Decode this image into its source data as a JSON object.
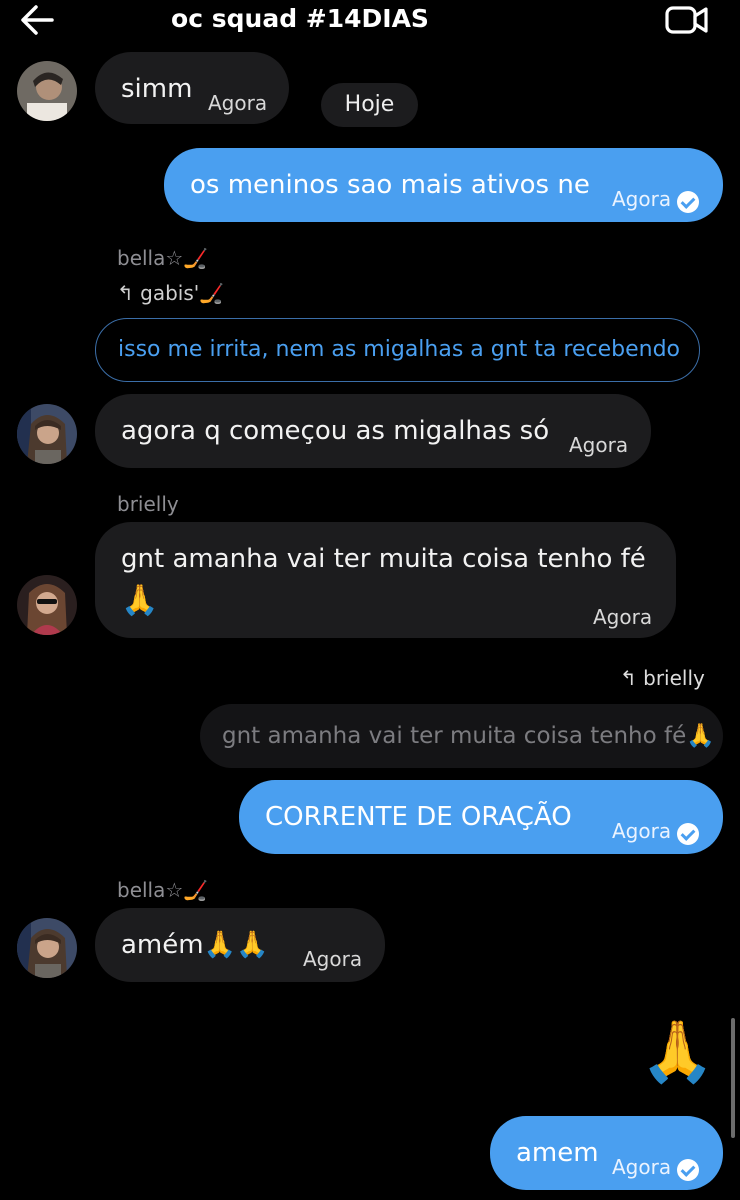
{
  "header": {
    "title": "oc squad #14DIAS",
    "back_icon": "arrow-left-icon",
    "video_icon": "video-camera-icon"
  },
  "colors": {
    "background": "#000000",
    "incoming": "#1c1c1e",
    "outgoing": "#4a9ff0",
    "quote_outline": "#3b6ea8"
  },
  "date_separator": "Hoje",
  "messages": [
    {
      "text": "simm",
      "time": "Agora"
    },
    {
      "text": "os meninos sao mais ativos ne",
      "time": "Agora"
    },
    {
      "sender": "bella☆🏒",
      "reply_to": "gabis'🏒",
      "quoted": "isso me irrita, nem as migalhas a gnt ta recebendo",
      "text": "agora q começou as migalhas só",
      "time": "Agora"
    },
    {
      "sender": "brielly",
      "text_line1": "gnt amanha vai ter muita coisa tenho fé",
      "text_line2": "🙏",
      "time": "Agora"
    },
    {
      "reply_to": "brielly",
      "quoted": "gnt amanha vai ter muita coisa tenho fé🙏",
      "text": "CORRENTE DE ORAÇÃO",
      "time": "Agora"
    },
    {
      "sender": "bella☆🏒",
      "text": "amém🙏🙏",
      "time": "Agora"
    },
    {
      "emoji": "🙏"
    },
    {
      "text": "amem",
      "time": "Agora"
    }
  ]
}
